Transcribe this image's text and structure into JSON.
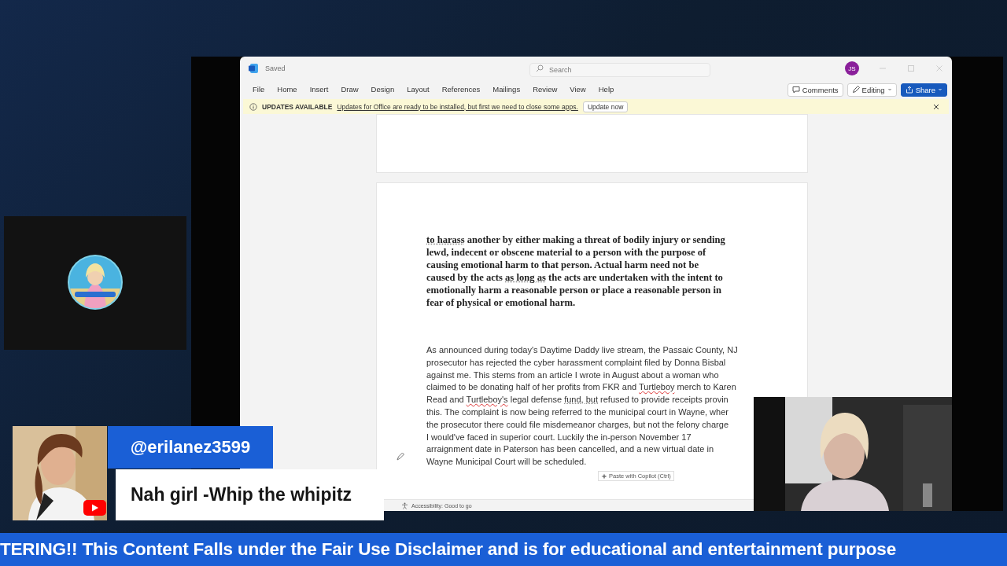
{
  "word_window": {
    "title": "Saved",
    "search": {
      "placeholder": "Search"
    },
    "account_initials": "JS",
    "ribbon_tabs": [
      {
        "label": "File",
        "selected": false
      },
      {
        "label": "Home",
        "selected": false
      },
      {
        "label": "Insert",
        "selected": false
      },
      {
        "label": "Draw",
        "selected": false
      },
      {
        "label": "Design",
        "selected": false
      },
      {
        "label": "Layout",
        "selected": false
      },
      {
        "label": "References",
        "selected": false
      },
      {
        "label": "Mailings",
        "selected": false
      },
      {
        "label": "Review",
        "selected": false
      },
      {
        "label": "View",
        "selected": false
      },
      {
        "label": "Help",
        "selected": false
      }
    ],
    "ribbon_buttons": [
      {
        "kind": "comments",
        "label": "Comments"
      },
      {
        "kind": "editing",
        "label": "Editing"
      },
      {
        "kind": "share",
        "label": "Share"
      }
    ],
    "update_bar": {
      "heading": "UPDATES AVAILABLE",
      "message": "Updates for Office are ready to be installed, but first we need to close some apps.",
      "button": "Update now"
    },
    "document": {
      "quote_lines": [
        [
          {
            "text": "to harass",
            "grammar_issue": true
          },
          {
            "text": " another by either making a threat of bodily injury or sending"
          }
        ],
        [
          {
            "text": "lewd, indecent or obscene material to a person with the purpose of"
          }
        ],
        [
          {
            "text": "causing emotional harm to that person. Actual harm need not be"
          }
        ],
        [
          {
            "text": "caused by the acts "
          },
          {
            "text": "as long as",
            "grammar_issue": true
          },
          {
            "text": " the acts are undertaken with the intent to"
          }
        ],
        [
          {
            "text": "emotionally harm a reasonable person or place a reasonable person in"
          }
        ],
        [
          {
            "text": "fear of physical or emotional harm."
          }
        ]
      ],
      "body_lines": [
        [
          {
            "text": "As announced during today's Daytime Daddy live stream, the Passaic County, NJ"
          }
        ],
        [
          {
            "text": "prosecutor has rejected the cyber harassment complaint filed by Donna Bisbal"
          }
        ],
        [
          {
            "text": "against me. This stems from an article I wrote in August about a woman who"
          }
        ],
        [
          {
            "text": "claimed to be donating half of her profits from FKR and "
          },
          {
            "text": "Turtleboy",
            "misspelled": true
          },
          {
            "text": " merch to Karen"
          }
        ],
        [
          {
            "text": "Read and "
          },
          {
            "text": "Turtleboy's",
            "misspelled": true
          },
          {
            "text": " legal defense "
          },
          {
            "text": "fund, but",
            "grammar_issue": true
          },
          {
            "text": " refused to provide receipts provin"
          }
        ],
        [
          {
            "text": "this. The complaint is now being referred to the municipal court in Wayne, wher"
          }
        ],
        [
          {
            "text": "the prosecutor there could file misdemeanor charges, but not the felony charge"
          }
        ],
        [
          {
            "text": "I would've faced in superior court. Luckily the in-person November 17"
          }
        ],
        [
          {
            "text": "arraignment date in Paterson has been cancelled, and a new virtual date in"
          }
        ],
        [
          {
            "text": "Wayne Municipal Court will be scheduled."
          }
        ]
      ],
      "paste_button": "Paste with Copilot (Ctrl)"
    },
    "status_bar": {
      "accessibility": "Accessibility: Good to go"
    }
  },
  "chat": {
    "username": "@erilanez3599",
    "message": "Nah girl -Whip the whipitz"
  },
  "ticker": {
    "text": "TERING!! This Content Falls under the Fair Use Disclaimer and is for educational and entertainment purpose"
  }
}
